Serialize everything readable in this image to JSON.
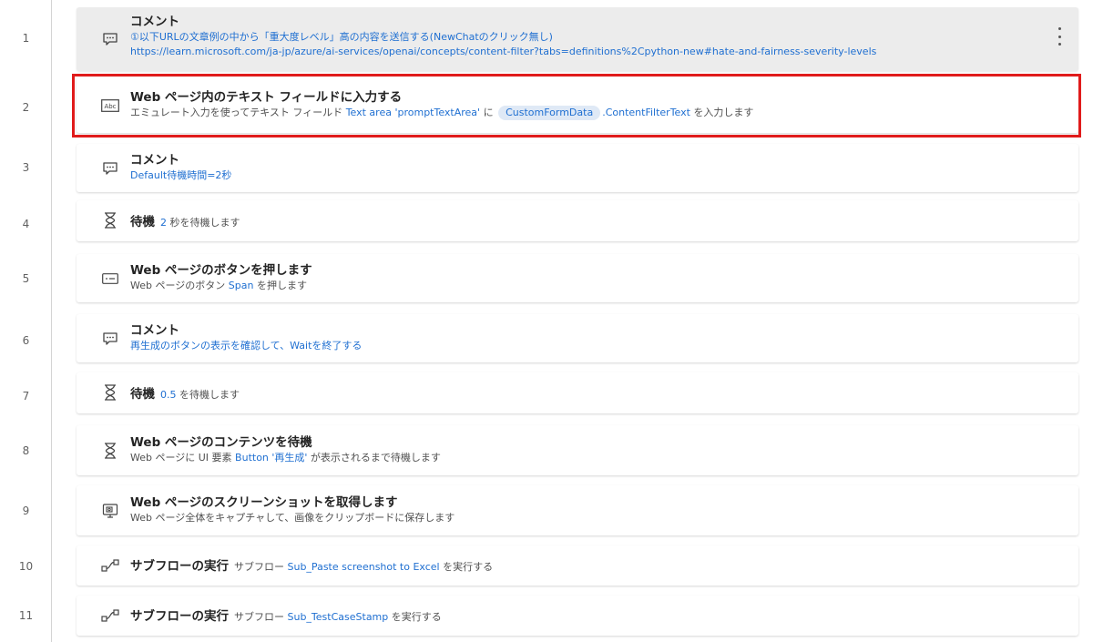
{
  "line_numbers": [
    "1",
    "2",
    "3",
    "4",
    "5",
    "6",
    "7",
    "8",
    "9",
    "10",
    "11"
  ],
  "steps": [
    {
      "title": "コメント",
      "line1": "①以下URLの文章例の中から「重大度レベル」高の内容を送信する(NewChatのクリック無し)",
      "line2": "https://learn.microsoft.com/ja-jp/azure/ai-services/openai/concepts/content-filter?tabs=definitions%2Cpython-new#hate-and-fairness-severity-levels",
      "icon": "comment-icon"
    },
    {
      "title": "Web ページ内のテキスト フィールドに入力する",
      "d1": "エミュレート入力を使ってテキスト フィールド",
      "d2": "Text area 'promptTextArea'",
      "d3": "に",
      "d4": "CustomFormData",
      "d5": ".ContentFilterText",
      "d6": "を入力します",
      "icon": "text-field-icon"
    },
    {
      "title": "コメント",
      "line1": "Default待機時間=2秒",
      "icon": "comment-icon"
    },
    {
      "title": "待機",
      "d1": "2",
      "d2": "秒を待機します",
      "icon": "hourglass-icon"
    },
    {
      "title": "Web ページのボタンを押します",
      "d1": "Web ページのボタン",
      "d2": "Span",
      "d3": "を押します",
      "icon": "button-icon"
    },
    {
      "title": "コメント",
      "line1": "再生成のボタンの表示を確認して、Waitを終了する",
      "icon": "comment-icon"
    },
    {
      "title": "待機",
      "d1": "0.5",
      "d2": "を待機します",
      "icon": "hourglass-icon"
    },
    {
      "title": "Web ページのコンテンツを待機",
      "d1": "Web ページに UI 要素",
      "d2": "Button '再生成'",
      "d3": "が表示されるまで待機します",
      "icon": "hourglass-icon"
    },
    {
      "title": "Web ページのスクリーンショットを取得します",
      "d1": "Web ページ全体をキャプチャして、画像をクリップボードに保存します",
      "icon": "screenshot-icon"
    },
    {
      "title": "サブフローの実行",
      "d1": "サブフロー",
      "d2": "Sub_Paste screenshot to Excel",
      "d3": "を実行する",
      "icon": "subflow-icon"
    },
    {
      "title": "サブフローの実行",
      "d1": "サブフロー",
      "d2": "Sub_TestCaseStamp",
      "d3": "を実行する",
      "icon": "subflow-icon"
    }
  ],
  "colors": {
    "highlight": "#e01b1b",
    "variable_blue": "#1f6fd1",
    "selected_bg": "#ececec"
  }
}
